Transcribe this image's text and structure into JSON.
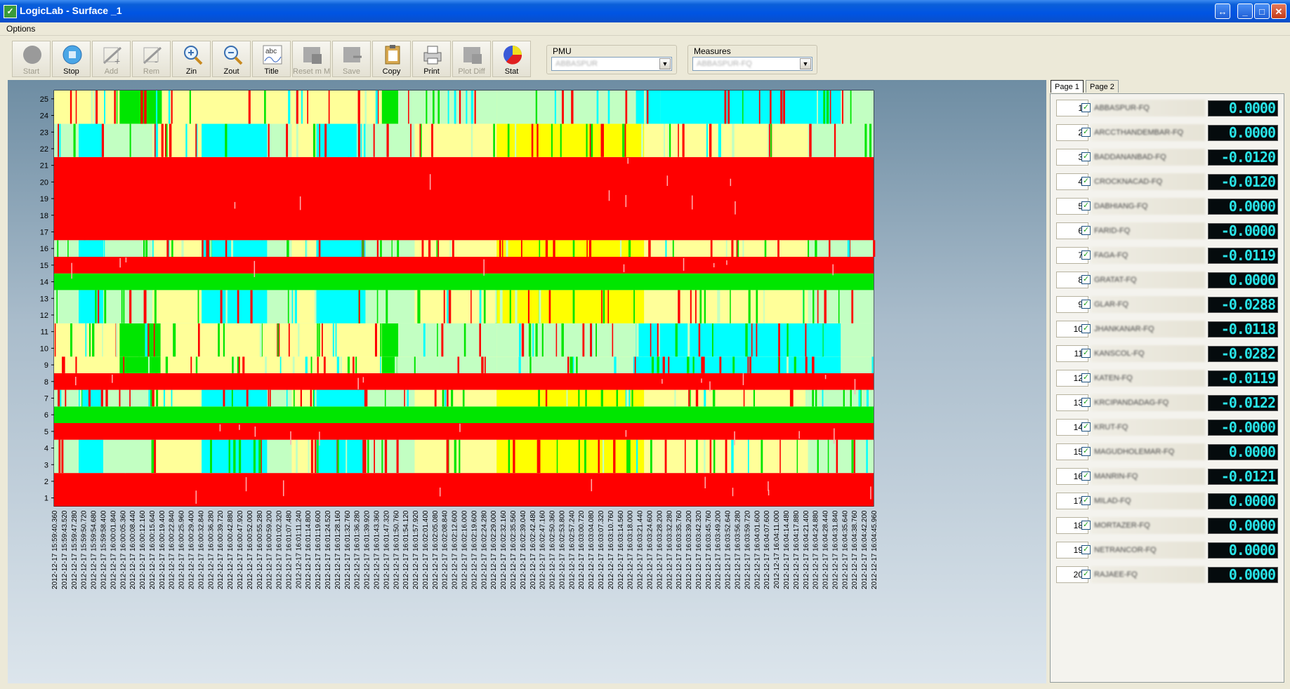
{
  "window": {
    "title": "LogicLab -  Surface _1"
  },
  "menu": {
    "options": "Options"
  },
  "toolbar": {
    "buttons": [
      {
        "label": "Start",
        "enabled": false,
        "icon": "circle-gray-icon"
      },
      {
        "label": "Stop",
        "enabled": true,
        "icon": "stop-icon"
      },
      {
        "label": "Add",
        "enabled": false,
        "icon": "add-trace-icon"
      },
      {
        "label": "Rem",
        "enabled": false,
        "icon": "remove-trace-icon"
      },
      {
        "label": "Zin",
        "enabled": true,
        "icon": "zoom-in-icon"
      },
      {
        "label": "Zout",
        "enabled": true,
        "icon": "zoom-out-icon"
      },
      {
        "label": "Title",
        "enabled": true,
        "icon": "title-icon"
      },
      {
        "label": "Reset m M",
        "enabled": false,
        "icon": "reset-icon"
      },
      {
        "label": "Save",
        "enabled": false,
        "icon": "save-icon"
      },
      {
        "label": "Copy",
        "enabled": true,
        "icon": "copy-icon"
      },
      {
        "label": "Print",
        "enabled": true,
        "icon": "printer-icon"
      },
      {
        "label": "Plot Diff",
        "enabled": false,
        "icon": "plot-diff-icon"
      },
      {
        "label": "Stat",
        "enabled": true,
        "icon": "pie-chart-icon"
      }
    ]
  },
  "pmu": {
    "label": "PMU",
    "value": "ABBASPUR"
  },
  "measures": {
    "label": "Measures",
    "value": "ABBASPUR-FQ"
  },
  "tabs": [
    "Page 1",
    "Page 2"
  ],
  "colors": {
    "red": "#ff0000",
    "green": "#00e600",
    "yellow": "#ffff00",
    "light_yellow": "#ffff99",
    "light_green": "#c2ffc2",
    "cyan": "#00ffff"
  },
  "chart_data": {
    "type": "heatmap",
    "title": "",
    "xlabel": "",
    "ylabel": "",
    "y_categories": [
      "1",
      "2",
      "3",
      "4",
      "5",
      "6",
      "7",
      "8",
      "9",
      "10",
      "11",
      "12",
      "13",
      "14",
      "15",
      "16",
      "17",
      "18",
      "19",
      "20",
      "21",
      "22",
      "23",
      "24",
      "25"
    ],
    "x_tick_labels": [
      "2012-12-17 15:59:40.360",
      "2012-12-17 15:59:43.520",
      "2012-12-17 15:59:47.280",
      "2012-12-17 15:59:50.720",
      "2012-12-17 15:59:54.680",
      "2012-12-17 15:59:58.400",
      "2012-12-17 16:00:01.840",
      "2012-12-17 16:00:05.360",
      "2012-12-17 16:00:08.440",
      "2012-12-17 16:00:12.160",
      "2012-12-17 16:00:15.640",
      "2012-12-17 16:00:19.400",
      "2012-12-17 16:00:22.840",
      "2012-12-17 16:00:25.960",
      "2012-12-17 16:00:29.400",
      "2012-12-17 16:00:32.840",
      "2012-12-17 16:00:36.280",
      "2012-12-17 16:00:39.720",
      "2012-12-17 16:00:42.880",
      "2012-12-17 16:00:47.920",
      "2012-12-17 16:00:52.000",
      "2012-12-17 16:00:55.280",
      "2012-12-17 16:00:59.200",
      "2012-12-17 16:01:02.320",
      "2012-12-17 16:01:07.480",
      "2012-12-17 16:01:11.240",
      "2012-12-17 16:01:14.800",
      "2012-12-17 16:01:19.600",
      "2012-12-17 16:01:24.520",
      "2012-12-17 16:01:28.160",
      "2012-12-17 16:01:32.760",
      "2012-12-17 16:01:36.280",
      "2012-12-17 16:01:39.920",
      "2012-12-17 16:01:43.360",
      "2012-12-17 16:01:47.320",
      "2012-12-17 16:01:50.760",
      "2012-12-17 16:01:54.120",
      "2012-12-17 16:01:57.920",
      "2012-12-17 16:02:01.400",
      "2012-12-17 16:02:05.080",
      "2012-12-17 16:02:08.840",
      "2012-12-17 16:02:12.600",
      "2012-12-17 16:02:16.000",
      "2012-12-17 16:02:19.600",
      "2012-12-17 16:02:24.280",
      "2012-12-17 16:02:29.000",
      "2012-12-17 16:02:32.160",
      "2012-12-17 16:02:35.560",
      "2012-12-17 16:02:39.040",
      "2012-12-17 16:02:42.480",
      "2012-12-17 16:02:47.160",
      "2012-12-17 16:02:50.360",
      "2012-12-17 16:02:53.800",
      "2012-12-17 16:02:57.240",
      "2012-12-17 16:03:00.720",
      "2012-12-17 16:03:04.080",
      "2012-12-17 16:03:07.320",
      "2012-12-17 16:03:10.760",
      "2012-12-17 16:03:14.560",
      "2012-12-17 16:03:18.000",
      "2012-12-17 16:03:21.440",
      "2012-12-17 16:03:24.600",
      "2012-12-17 16:03:28.200",
      "2012-12-17 16:03:32.280",
      "2012-12-17 16:03:35.760",
      "2012-12-17 16:03:39.200",
      "2012-12-17 16:03:42.320",
      "2012-12-17 16:03:45.760",
      "2012-12-17 16:03:49.200",
      "2012-12-17 16:03:52.640",
      "2012-12-17 16:03:56.280",
      "2012-12-17 16:03:59.720",
      "2012-12-17 16:04:01.600",
      "2012-12-17 16:04:07.600",
      "2012-12-17 16:04:11.000",
      "2012-12-17 16:04:14.480",
      "2012-12-17 16:04:17.880",
      "2012-12-17 16:04:21.400",
      "2012-12-17 16:04:24.880",
      "2012-12-17 16:04:28.440",
      "2012-12-17 16:04:31.840",
      "2012-12-17 16:04:35.640",
      "2012-12-17 16:04:38.760",
      "2012-12-17 16:04:42.200",
      "2012-12-17 16:04:45.960"
    ],
    "rows": [
      {
        "rows": [
          1,
          2
        ],
        "base": "red"
      },
      {
        "rows": [
          3,
          4
        ],
        "base": "light_green",
        "pattern": "mixed"
      },
      {
        "rows": [
          5
        ],
        "base": "red"
      },
      {
        "rows": [
          6
        ],
        "base": "green"
      },
      {
        "rows": [
          7
        ],
        "base": "light_green",
        "pattern": "mixed"
      },
      {
        "rows": [
          8
        ],
        "base": "red"
      },
      {
        "rows": [
          9
        ],
        "base": "light_yellow",
        "pattern": "upper"
      },
      {
        "rows": [
          10,
          11
        ],
        "base": "light_yellow",
        "pattern": "upper"
      },
      {
        "rows": [
          12,
          13
        ],
        "base": "light_green",
        "pattern": "mixed"
      },
      {
        "rows": [
          14
        ],
        "base": "green"
      },
      {
        "rows": [
          15
        ],
        "base": "red"
      },
      {
        "rows": [
          16
        ],
        "base": "light_green",
        "pattern": "mixed"
      },
      {
        "rows": [
          17,
          18,
          19,
          20,
          21
        ],
        "base": "red"
      },
      {
        "rows": [
          22,
          23
        ],
        "base": "light_green",
        "pattern": "mixed"
      },
      {
        "rows": [
          24,
          25
        ],
        "base": "light_yellow",
        "pattern": "upper"
      }
    ]
  },
  "measures_list": [
    {
      "index": "1",
      "name": "ABBASPUR-FQ",
      "value": "0.0000"
    },
    {
      "index": "2",
      "name": "ARCCTHANDEMBAR-FQ",
      "value": "0.0000"
    },
    {
      "index": "3",
      "name": "BADDANANBAD-FQ",
      "value": "-0.0120"
    },
    {
      "index": "4",
      "name": "CROCKNACAD-FQ",
      "value": "-0.0120"
    },
    {
      "index": "5",
      "name": "DABHIANG-FQ",
      "value": "0.0000"
    },
    {
      "index": "6",
      "name": "FARID-FQ",
      "value": "-0.0000"
    },
    {
      "index": "7",
      "name": "FAGA-FQ",
      "value": "-0.0119"
    },
    {
      "index": "8",
      "name": "GRATAT-FQ",
      "value": "0.0000"
    },
    {
      "index": "9",
      "name": "GLAR-FQ",
      "value": "-0.0288"
    },
    {
      "index": "10",
      "name": "JHANKANAR-FQ",
      "value": "-0.0118"
    },
    {
      "index": "11",
      "name": "KANSCOL-FQ",
      "value": "-0.0282"
    },
    {
      "index": "12",
      "name": "KATEN-FQ",
      "value": "-0.0119"
    },
    {
      "index": "13",
      "name": "KRCIPANDADAG-FQ",
      "value": "-0.0122"
    },
    {
      "index": "14",
      "name": "KRUT-FQ",
      "value": "-0.0000"
    },
    {
      "index": "15",
      "name": "MAGUDHOLEMAR-FQ",
      "value": "0.0000"
    },
    {
      "index": "16",
      "name": "MANRIN-FQ",
      "value": "-0.0121"
    },
    {
      "index": "17",
      "name": "MILAD-FQ",
      "value": "0.0000"
    },
    {
      "index": "18",
      "name": "MORTAZER-FQ",
      "value": "0.0000"
    },
    {
      "index": "19",
      "name": "NETRANCOR-FQ",
      "value": "0.0000"
    },
    {
      "index": "20",
      "name": "RAJAEE-FQ",
      "value": "0.0000"
    }
  ]
}
